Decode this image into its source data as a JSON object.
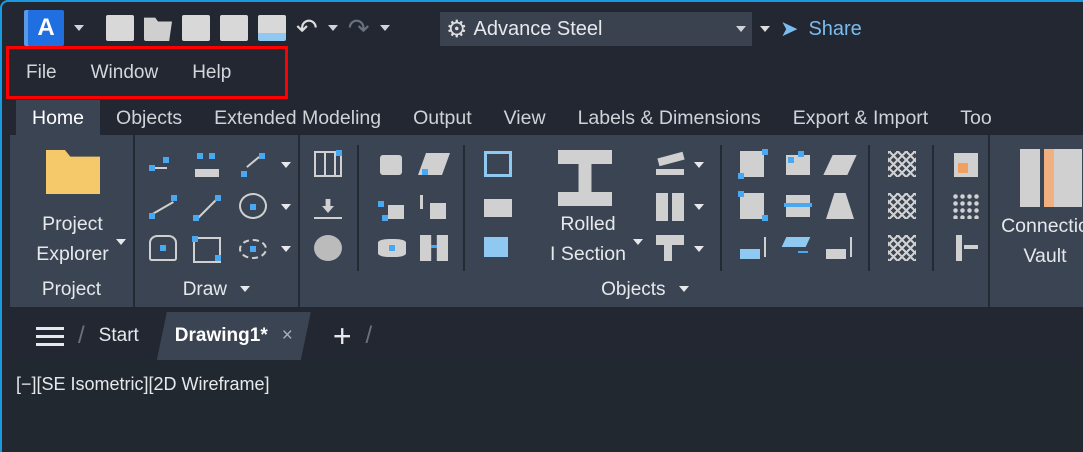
{
  "qat": {
    "logo": "A",
    "workspace": "Advance Steel",
    "share": "Share"
  },
  "menu": [
    "File",
    "Window",
    "Help"
  ],
  "ribbon_tabs": [
    "Home",
    "Objects",
    "Extended Modeling",
    "Output",
    "View",
    "Labels & Dimensions",
    "Export & Import",
    "Too"
  ],
  "panels": {
    "project": {
      "button_line1": "Project",
      "button_line2": "Explorer",
      "label": "Project"
    },
    "draw": {
      "label": "Draw"
    },
    "objects": {
      "button_line1": "Rolled",
      "button_line2": "I Section",
      "label": "Objects"
    },
    "vault": {
      "button_line1": "Connectio",
      "button_line2": "Vault"
    }
  },
  "doc_tabs": {
    "start": "Start",
    "active": "Drawing1*",
    "close": "×",
    "new": "+"
  },
  "viewport": {
    "label": "[−][SE Isometric][2D Wireframe]"
  },
  "colors": {
    "accent": "#1a9ae0",
    "highlight": "#ff0000",
    "ribbon": "#3b4453"
  }
}
